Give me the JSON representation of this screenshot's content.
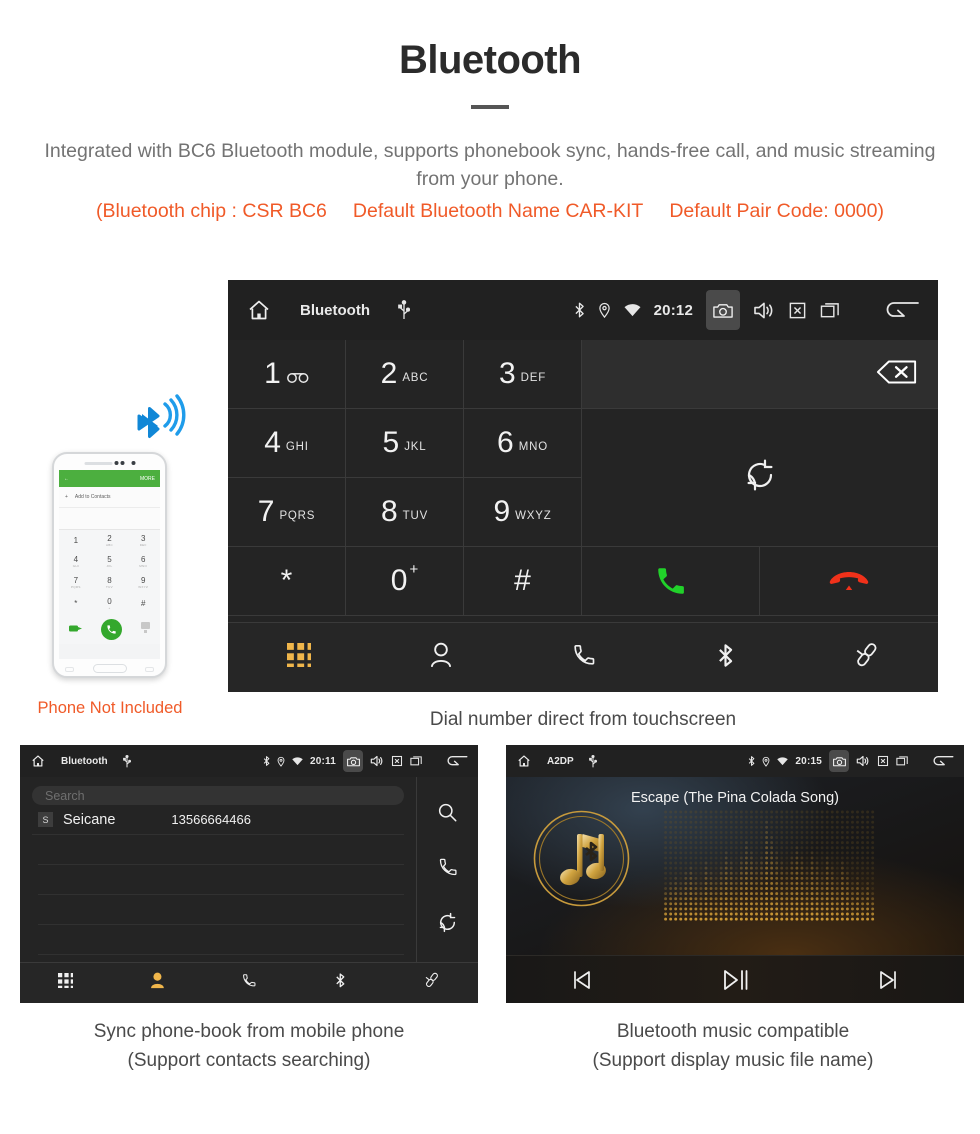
{
  "header": {
    "title": "Bluetooth",
    "description": "Integrated with BC6 Bluetooth module, supports phonebook sync, hands-free call, and music streaming from your phone.",
    "spec_chip": "(Bluetooth chip : CSR BC6",
    "spec_name": "Default Bluetooth Name CAR-KIT",
    "spec_pair": "Default Pair Code: 0000)",
    "accent_color": "#f05a28",
    "body_color": "#737373"
  },
  "dialer": {
    "statusbar": {
      "title": "Bluetooth",
      "time": "20:12",
      "icons": [
        "home-icon",
        "usb-icon",
        "bluetooth-icon",
        "location-icon",
        "wifi-icon",
        "camera-icon",
        "volume-icon",
        "close-icon",
        "recents-icon",
        "back-icon"
      ]
    },
    "keys": [
      {
        "digit": "1",
        "letters": "",
        "voicemail": true
      },
      {
        "digit": "2",
        "letters": "ABC"
      },
      {
        "digit": "3",
        "letters": "DEF"
      },
      {
        "digit": "4",
        "letters": "GHI"
      },
      {
        "digit": "5",
        "letters": "JKL"
      },
      {
        "digit": "6",
        "letters": "MNO"
      },
      {
        "digit": "7",
        "letters": "PQRS"
      },
      {
        "digit": "8",
        "letters": "TUV"
      },
      {
        "digit": "9",
        "letters": "WXYZ"
      },
      {
        "digit": "*",
        "letters": ""
      },
      {
        "digit": "0",
        "letters": "",
        "plus": "+"
      },
      {
        "digit": "#",
        "letters": ""
      }
    ],
    "number_display": "",
    "actions": {
      "backspace": "backspace-icon",
      "sync": "sync-icon",
      "call": "call-icon",
      "hangup": "hangup-icon"
    },
    "tabs": [
      {
        "name": "keypad",
        "active": true
      },
      {
        "name": "contacts",
        "active": false
      },
      {
        "name": "call-log",
        "active": false
      },
      {
        "name": "bluetooth",
        "active": false
      },
      {
        "name": "pair-link",
        "active": false
      }
    ],
    "caption": "Dial number direct from touchscreen",
    "active_tab_color": "#f0b64b"
  },
  "phone_mockup": {
    "more_label": "MORE",
    "add_contacts_label": "Add to Contacts",
    "keys": [
      {
        "digit": "1",
        "letters": ""
      },
      {
        "digit": "2",
        "letters": "ABC"
      },
      {
        "digit": "3",
        "letters": "DEF"
      },
      {
        "digit": "4",
        "letters": "GHI"
      },
      {
        "digit": "5",
        "letters": "JKL"
      },
      {
        "digit": "6",
        "letters": "MNO"
      },
      {
        "digit": "7",
        "letters": "PQRS"
      },
      {
        "digit": "8",
        "letters": "TUV"
      },
      {
        "digit": "9",
        "letters": "WXYZ"
      },
      {
        "digit": "*",
        "letters": ""
      },
      {
        "digit": "0",
        "letters": "+"
      },
      {
        "digit": "#",
        "letters": ""
      }
    ],
    "note": "Phone Not Included",
    "green_color": "#4caf3f",
    "bluetooth_color": "#0d86d8"
  },
  "phonebook": {
    "statusbar": {
      "title": "Bluetooth",
      "time": "20:11"
    },
    "search_placeholder": "Search",
    "contacts": [
      {
        "initial": "S",
        "name": "Seicane",
        "number": "13566664466"
      }
    ],
    "empty_rows": 4,
    "rail_icons": [
      "search-icon",
      "call-icon",
      "sync-icon"
    ],
    "tabs": [
      {
        "name": "keypad",
        "active": false
      },
      {
        "name": "contacts",
        "active": true
      },
      {
        "name": "call-log",
        "active": false
      },
      {
        "name": "bluetooth",
        "active": false
      },
      {
        "name": "pair-link",
        "active": false
      }
    ],
    "caption_line1": "Sync phone-book from mobile phone",
    "caption_line2": "(Support contacts searching)"
  },
  "music": {
    "statusbar": {
      "title": "A2DP",
      "time": "20:15"
    },
    "track_title": "Escape (The Pina Colada Song)",
    "controls": [
      "previous-icon",
      "play-pause-icon",
      "next-icon"
    ],
    "caption_line1": "Bluetooth music compatible",
    "caption_line2": "(Support display music file name)",
    "accent_color": "#c79a3c"
  }
}
